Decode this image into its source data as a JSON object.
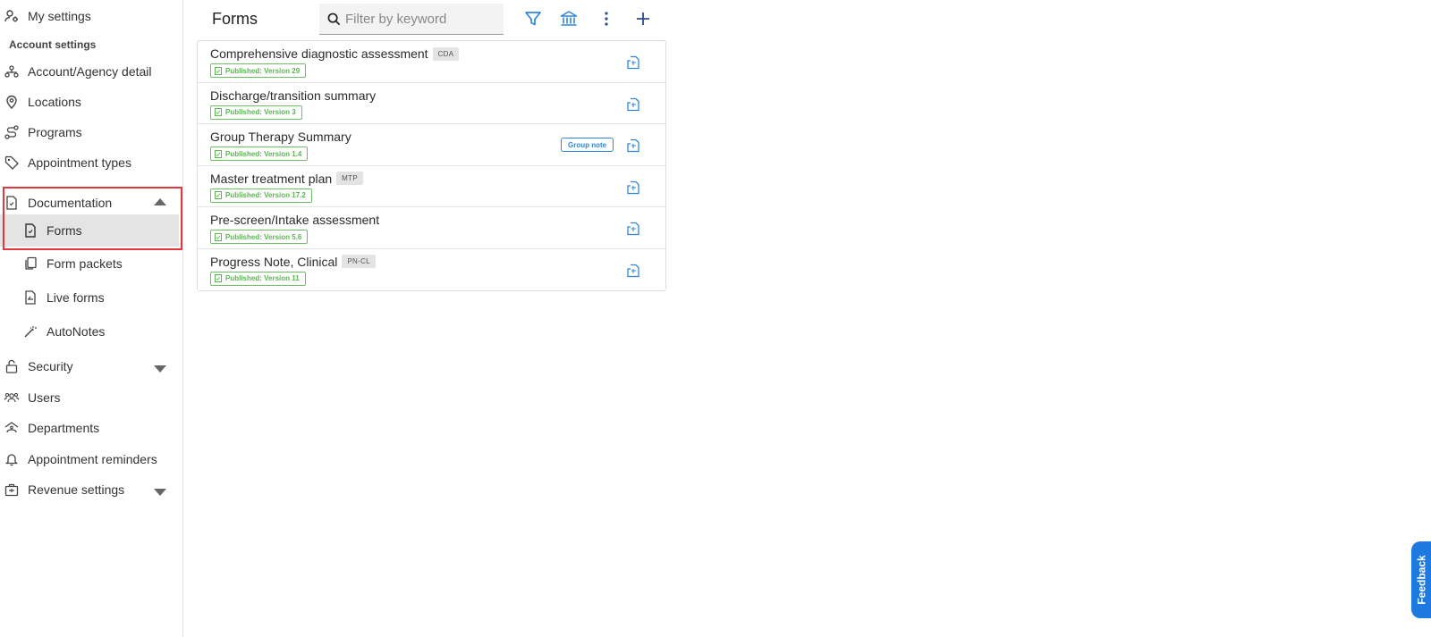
{
  "sidebar": {
    "my_settings": "My settings",
    "section_label": "Account settings",
    "items": [
      {
        "label": "Account/Agency detail"
      },
      {
        "label": "Locations"
      },
      {
        "label": "Programs"
      },
      {
        "label": "Appointment types"
      },
      {
        "label": "Documentation"
      },
      {
        "label": "Forms"
      },
      {
        "label": "Form packets"
      },
      {
        "label": "Live forms"
      },
      {
        "label": "AutoNotes"
      },
      {
        "label": "Security"
      },
      {
        "label": "Users"
      },
      {
        "label": "Departments"
      },
      {
        "label": "Appointment reminders"
      },
      {
        "label": "Revenue settings"
      }
    ]
  },
  "header": {
    "title": "Forms",
    "search_placeholder": "Filter by keyword"
  },
  "forms": [
    {
      "title": "Comprehensive diagnostic assessment",
      "abbr": "CDA",
      "status": "Published: Version 29"
    },
    {
      "title": "Discharge/transition summary",
      "abbr": "",
      "status": "Published: Version 3"
    },
    {
      "title": "Group Therapy Summary",
      "abbr": "",
      "status": "Published: Version 1.4",
      "badge": "Group note"
    },
    {
      "title": "Master treatment plan",
      "abbr": "MTP",
      "status": "Published: Version 17.2"
    },
    {
      "title": "Pre-screen/Intake assessment",
      "abbr": "",
      "status": "Published: Version 5.6"
    },
    {
      "title": "Progress Note, Clinical",
      "abbr": "PN-CL",
      "status": "Published: Version 11"
    }
  ],
  "feedback_label": "Feedback",
  "colors": {
    "accent": "#2e86de",
    "published": "#5cb553",
    "highlight": "#e0383e"
  }
}
